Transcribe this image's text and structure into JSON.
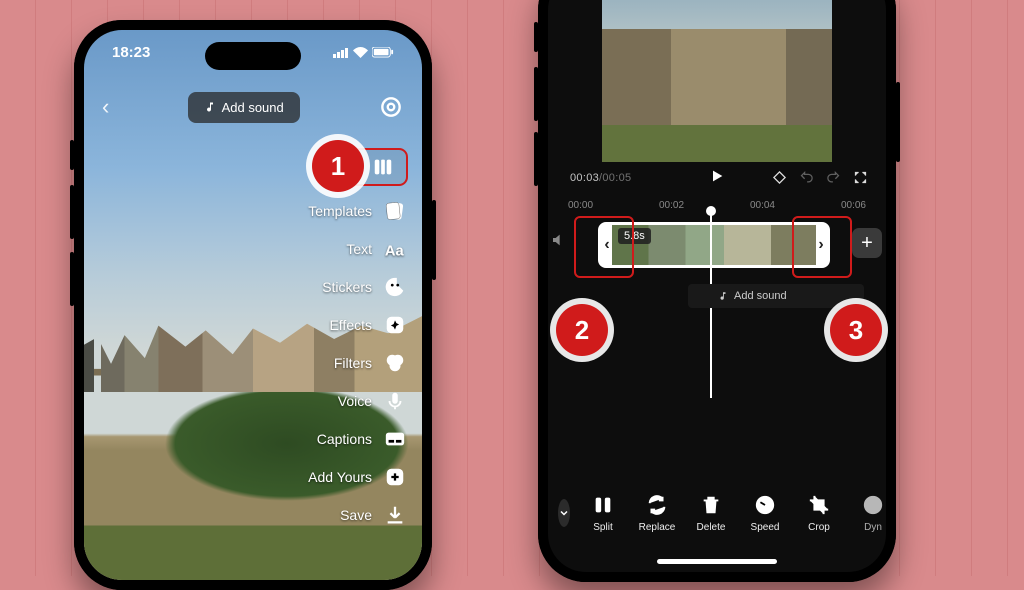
{
  "status_time": "18:23",
  "phone1": {
    "add_sound": "Add sound",
    "tools": [
      {
        "name": "edit",
        "label": "Edit"
      },
      {
        "name": "templates",
        "label": "Templates"
      },
      {
        "name": "text",
        "label": "Text"
      },
      {
        "name": "stickers",
        "label": "Stickers"
      },
      {
        "name": "effects",
        "label": "Effects"
      },
      {
        "name": "filters",
        "label": "Filters"
      },
      {
        "name": "voice",
        "label": "Voice"
      },
      {
        "name": "captions",
        "label": "Captions"
      },
      {
        "name": "addyours",
        "label": "Add Yours"
      },
      {
        "name": "save",
        "label": "Save"
      }
    ]
  },
  "phone2": {
    "time_current": "00:03",
    "time_total": "00:05",
    "clip_len": "5.8s",
    "ruler": [
      "00:00",
      "00:02",
      "00:04",
      "00:06"
    ],
    "add_sound": "Add sound",
    "tools": [
      {
        "name": "split",
        "label": "Split"
      },
      {
        "name": "replace",
        "label": "Replace"
      },
      {
        "name": "delete",
        "label": "Delete"
      },
      {
        "name": "speed",
        "label": "Speed"
      },
      {
        "name": "crop",
        "label": "Crop"
      },
      {
        "name": "dynamic",
        "label": "Dyn"
      }
    ]
  },
  "callouts": {
    "c1": "1",
    "c2": "2",
    "c3": "3"
  }
}
